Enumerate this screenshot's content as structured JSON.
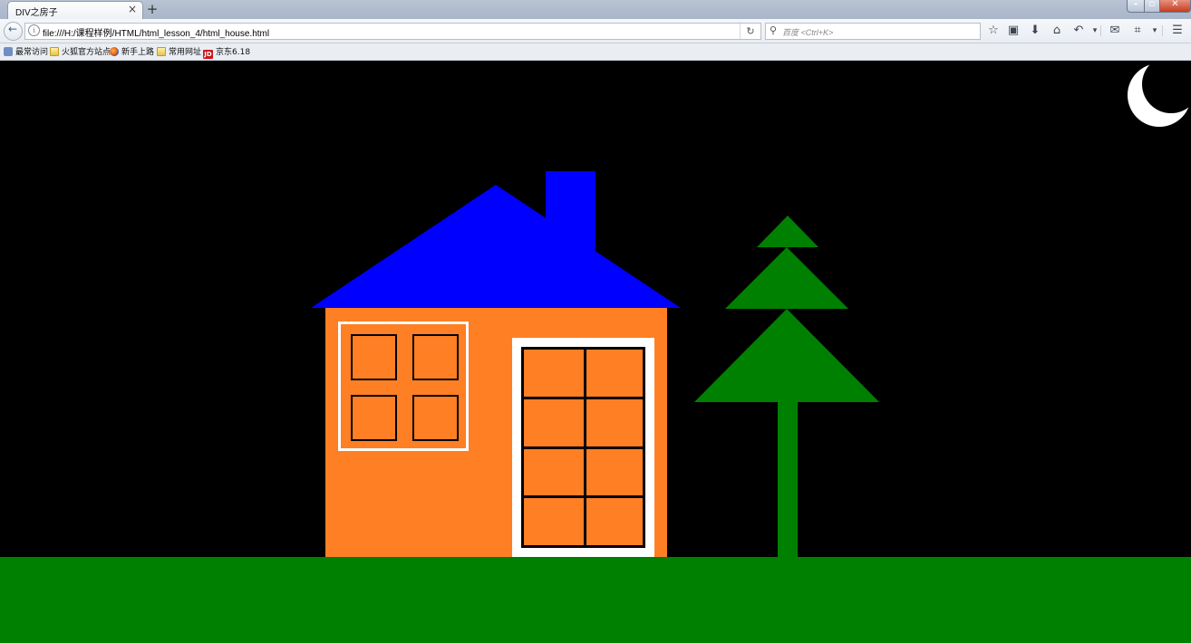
{
  "browser": {
    "tab_title": "DIV之房子",
    "tab_close": "×",
    "new_tab": "+",
    "url": "file:///H:/课程样例/HTML/html_lesson_4/html_house.html",
    "search_placeholder": "百度 <Ctrl+K>",
    "bookmarks": [
      {
        "label": "最常访问",
        "icon": "most-visited-icon"
      },
      {
        "label": "火狐官方站点",
        "icon": "folder-icon"
      },
      {
        "label": "新手上路",
        "icon": "firefox-icon"
      },
      {
        "label": "常用网址",
        "icon": "folder-icon"
      },
      {
        "label": "京东6.18",
        "icon": "jd-icon"
      }
    ],
    "toolbar_icons": [
      "star-icon",
      "clipboard-icon",
      "download-icon",
      "home-icon",
      "undo-icon",
      "chat-icon",
      "crop-icon",
      "menu-icon"
    ]
  },
  "scene": {
    "colors": {
      "sky": "#000000",
      "ground": "#008000",
      "roof": "#0000ff",
      "wall": "#ff7f24",
      "frame": "#ffffff",
      "tree": "#008000",
      "moon": "#ffffff"
    },
    "window_panes": 4,
    "door_panels": 8
  }
}
